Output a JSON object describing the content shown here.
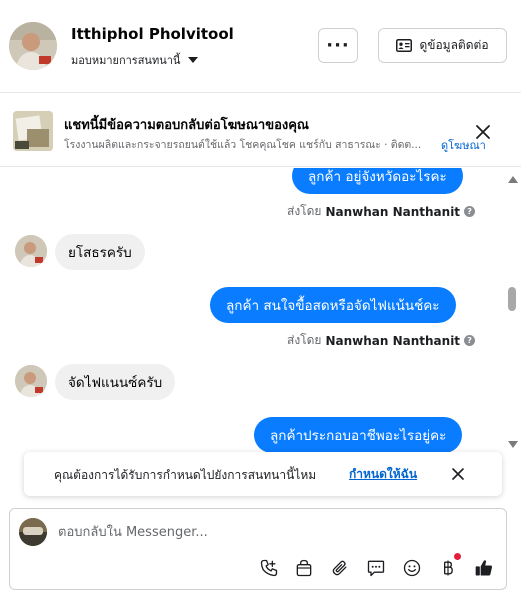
{
  "header": {
    "contact_name": "Itthiphol Pholvitool",
    "assign_label": "มอบหมายการสนทนานี้",
    "more_label": "···",
    "view_contact_label": "ดูข้อมูลติดต่อ"
  },
  "ad_banner": {
    "title": "แชทนี้มีข้อความตอบกลับต่อโฆษณาของคุณ",
    "description": "โรงงานผลิตและกระจายรถยนต์ใช้แล้ว โชคคุณโชค แชร์กับ สาธารณะ · ติดต...",
    "view_ad_link": "ดูโฆษณา"
  },
  "messages": [
    {
      "direction": "out",
      "text": "ลูกค้า  อยู่จังหวัดอะไรคะ",
      "sent_by_prefix": "ส่งโดย",
      "sent_by_name": "Nanwhan Nanthanit"
    },
    {
      "direction": "in",
      "text": "ยโสธรครับ"
    },
    {
      "direction": "out",
      "text": "ลูกค้า สนใจขื้อสดหรือจัดไฟแน้นช์คะ",
      "sent_by_prefix": "ส่งโดย",
      "sent_by_name": "Nanwhan Nanthanit"
    },
    {
      "direction": "in",
      "text": "จัดไฟแนนซ์ครับ"
    },
    {
      "direction": "out",
      "text": "ลูกค้าประกอบอาชีพอะไรอยู่คะ"
    }
  ],
  "reminder": {
    "text": "คุณต้องการได้รับการกำหนดไปยังการสนทนานี้ไหม",
    "link": "กำหนดให้ฉัน"
  },
  "composer": {
    "placeholder": "ตอบกลับใน Messenger..."
  },
  "toolbar_icons": [
    "call-icon",
    "shopping-bag-icon",
    "paperclip-icon",
    "saved-replies-icon",
    "emoji-icon",
    "baht-icon",
    "thumbs-up-icon"
  ],
  "colors": {
    "outgoing_bubble": "#0a7cff",
    "incoming_bubble": "#f0f0f0",
    "link": "#0064d1",
    "notification": "#e41e3f"
  }
}
